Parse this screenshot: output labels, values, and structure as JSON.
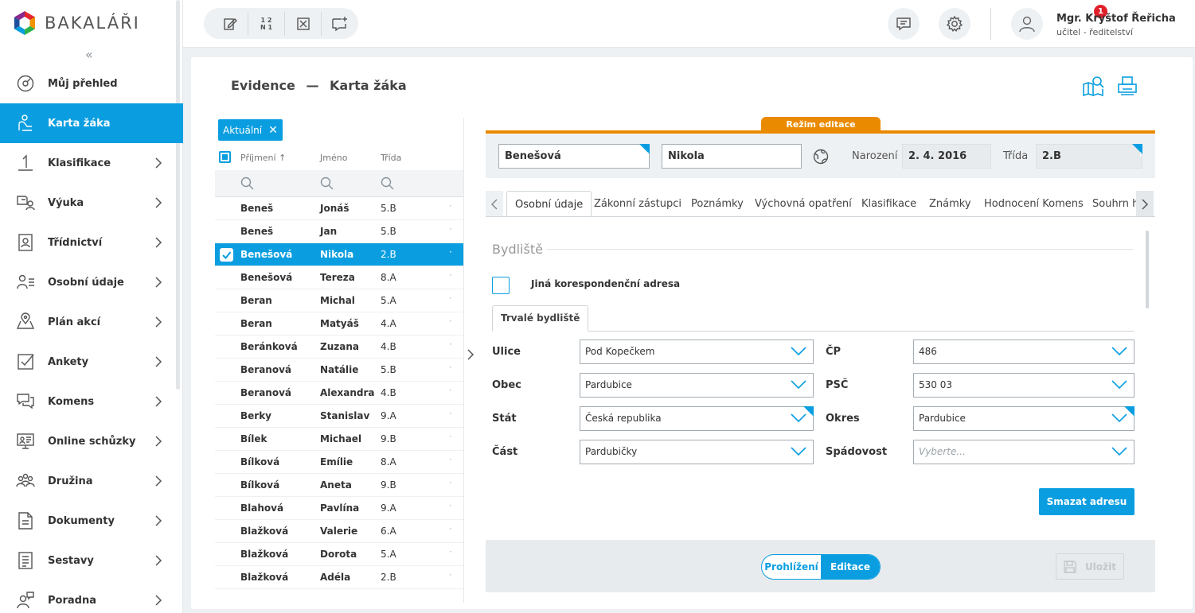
{
  "app": {
    "logo_text": "BAKALÁŘI",
    "collapse_glyph": "«"
  },
  "sidebar": {
    "items": [
      {
        "label": "Můj přehled",
        "icon": "dashboard-icon",
        "chevron": false,
        "active": false
      },
      {
        "label": "Karta žáka",
        "icon": "student-card-icon",
        "chevron": false,
        "active": true
      },
      {
        "label": "Klasifikace",
        "icon": "grade-one-icon",
        "chevron": true,
        "active": false
      },
      {
        "label": "Výuka",
        "icon": "teaching-icon",
        "chevron": true,
        "active": false
      },
      {
        "label": "Třídnictví",
        "icon": "class-teacher-icon",
        "chevron": true,
        "active": false
      },
      {
        "label": "Osobní údaje",
        "icon": "personal-data-icon",
        "chevron": true,
        "active": false
      },
      {
        "label": "Plán akcí",
        "icon": "map-pin-icon",
        "chevron": true,
        "active": false
      },
      {
        "label": "Ankety",
        "icon": "survey-check-icon",
        "chevron": true,
        "active": false
      },
      {
        "label": "Komens",
        "icon": "chat-icon",
        "chevron": true,
        "active": false
      },
      {
        "label": "Online schůzky",
        "icon": "online-meeting-icon",
        "chevron": true,
        "active": false
      },
      {
        "label": "Družina",
        "icon": "group-icon",
        "chevron": true,
        "active": false
      },
      {
        "label": "Dokumenty",
        "icon": "document-icon",
        "chevron": true,
        "active": false
      },
      {
        "label": "Sestavy",
        "icon": "report-icon",
        "chevron": true,
        "active": false
      },
      {
        "label": "Poradna",
        "icon": "counseling-icon",
        "chevron": true,
        "active": false
      }
    ]
  },
  "topbar": {
    "tool_fraction": "1 2\nN 1",
    "message_badge": "1",
    "user_name": "Mgr. Kryštof Řeřicha",
    "user_role": "učitel - ředitelství"
  },
  "page": {
    "breadcrumb_section": "Evidence",
    "breadcrumb_sep": "—",
    "breadcrumb_page": "Karta žáka"
  },
  "list": {
    "filter_chip": "Aktuální",
    "filter_close": "✕",
    "headers": {
      "surname": "Příjmení",
      "surname_sort": "↑",
      "firstname": "Jméno",
      "class": "Třída"
    },
    "rows": [
      {
        "surname": "Beneš",
        "firstname": "Jonáš",
        "class": "5.B",
        "selected": false
      },
      {
        "surname": "Beneš",
        "firstname": "Jan",
        "class": "5.B",
        "selected": false
      },
      {
        "surname": "Benešová",
        "firstname": "Nikola",
        "class": "2.B",
        "selected": true
      },
      {
        "surname": "Benešová",
        "firstname": "Tereza",
        "class": "8.A",
        "selected": false
      },
      {
        "surname": "Beran",
        "firstname": "Michal",
        "class": "5.A",
        "selected": false
      },
      {
        "surname": "Beran",
        "firstname": "Matyáš",
        "class": "4.A",
        "selected": false
      },
      {
        "surname": "Beránková",
        "firstname": "Zuzana",
        "class": "4.B",
        "selected": false
      },
      {
        "surname": "Beranová",
        "firstname": "Natálie",
        "class": "5.B",
        "selected": false
      },
      {
        "surname": "Beranová",
        "firstname": "Alexandra",
        "class": "4.B",
        "selected": false
      },
      {
        "surname": "Berky",
        "firstname": "Stanislav",
        "class": "9.A",
        "selected": false
      },
      {
        "surname": "Bílek",
        "firstname": "Michael",
        "class": "9.B",
        "selected": false
      },
      {
        "surname": "Bílková",
        "firstname": "Emílie",
        "class": "8.A",
        "selected": false
      },
      {
        "surname": "Bílková",
        "firstname": "Aneta",
        "class": "9.B",
        "selected": false
      },
      {
        "surname": "Blahová",
        "firstname": "Pavlína",
        "class": "9.A",
        "selected": false
      },
      {
        "surname": "Blažková",
        "firstname": "Valerie",
        "class": "6.A",
        "selected": false
      },
      {
        "surname": "Blažková",
        "firstname": "Dorota",
        "class": "5.A",
        "selected": false
      },
      {
        "surname": "Blažková",
        "firstname": "Adéla",
        "class": "2.B",
        "selected": false
      }
    ],
    "row_dot": "·"
  },
  "editor": {
    "mode_label": "Režim editace",
    "surname": "Benešová",
    "firstname": "Nikola",
    "birth_label": "Narození",
    "birth_value": "2. 4. 2016",
    "class_label": "Třída",
    "class_value": "2.B",
    "tabs": [
      "Osobní údaje",
      "Zákonní zástupci",
      "Poznámky",
      "Výchovná opatření",
      "Klasifikace",
      "Známky",
      "Hodnocení Komens",
      "Souhrn h"
    ],
    "active_tab": 0
  },
  "form": {
    "section_title": "Bydliště",
    "alt_address_label": "Jiná korespondenční adresa",
    "subtab": "Trvalé bydliště",
    "fields": {
      "ulice": {
        "label": "Ulice",
        "value": "Pod Kopečkem"
      },
      "cp": {
        "label": "ČP",
        "value": "486"
      },
      "obec": {
        "label": "Obec",
        "value": "Pardubice"
      },
      "psc": {
        "label": "PSČ",
        "value": "530 03"
      },
      "stat": {
        "label": "Stát",
        "value": "Česká republika"
      },
      "okres": {
        "label": "Okres",
        "value": "Pardubice"
      },
      "cast": {
        "label": "Část",
        "value": "Pardubičky"
      },
      "spadovost": {
        "label": "Spádovost",
        "placeholder": "Vyberte..."
      }
    },
    "delete_button": "Smazat adresu"
  },
  "footer": {
    "view_label": "Prohlížení",
    "edit_label": "Editace",
    "save_label": "Uložit"
  },
  "colors": {
    "accent": "#0a9ee0",
    "edit_mode": "#ea8a00",
    "badge": "#e0202b"
  }
}
